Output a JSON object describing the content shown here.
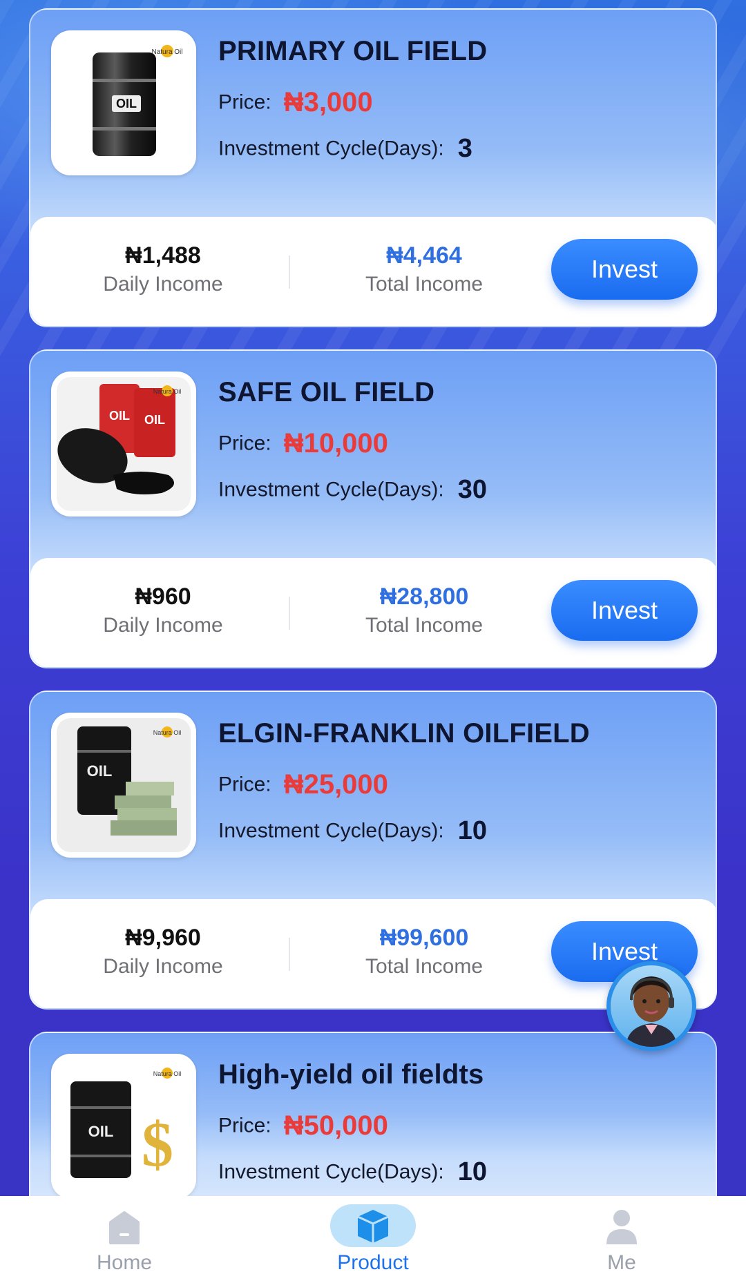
{
  "currency_symbol": "₦",
  "price_label": "Price:",
  "cycle_label": "Investment Cycle(Days):",
  "daily_label": "Daily Income",
  "total_label": "Total Income",
  "invest_label": "Invest",
  "products": [
    {
      "name": "PRIMARY OIL FIELD",
      "price": "₦3,000",
      "cycle_days": "3",
      "daily_income": "₦1,488",
      "total_income": "₦4,464",
      "image": "oil-barrel-single",
      "logo_text": "Natura Oil",
      "barrel_text": "OIL"
    },
    {
      "name": "SAFE OIL FIELD",
      "price": "₦10,000",
      "cycle_days": "30",
      "daily_income": "₦960",
      "total_income": "₦28,800",
      "image": "oil-barrels-spill",
      "logo_text": "Natura Oil",
      "barrel_text": "OIL"
    },
    {
      "name": "ELGIN-FRANKLIN OILFIELD",
      "price": "₦25,000",
      "cycle_days": "10",
      "daily_income": "₦9,960",
      "total_income": "₦99,600",
      "image": "oil-barrel-money",
      "logo_text": "Natura Oil",
      "barrel_text": "OIL"
    },
    {
      "name": "High-yield oil fieldts",
      "price": "₦50,000",
      "cycle_days": "10",
      "image": "oil-barrel-dollar",
      "logo_text": "Natura Oil",
      "barrel_text": "OIL"
    }
  ],
  "tabs": [
    {
      "label": "Home",
      "icon": "home-icon",
      "active": false
    },
    {
      "label": "Product",
      "icon": "box-icon",
      "active": true
    },
    {
      "label": "Me",
      "icon": "user-icon",
      "active": false
    }
  ],
  "colors": {
    "price": "#ea3b3b",
    "total_income": "#2f6fe0",
    "accent": "#1e73e8",
    "invest_button": "#1a6cf0"
  }
}
